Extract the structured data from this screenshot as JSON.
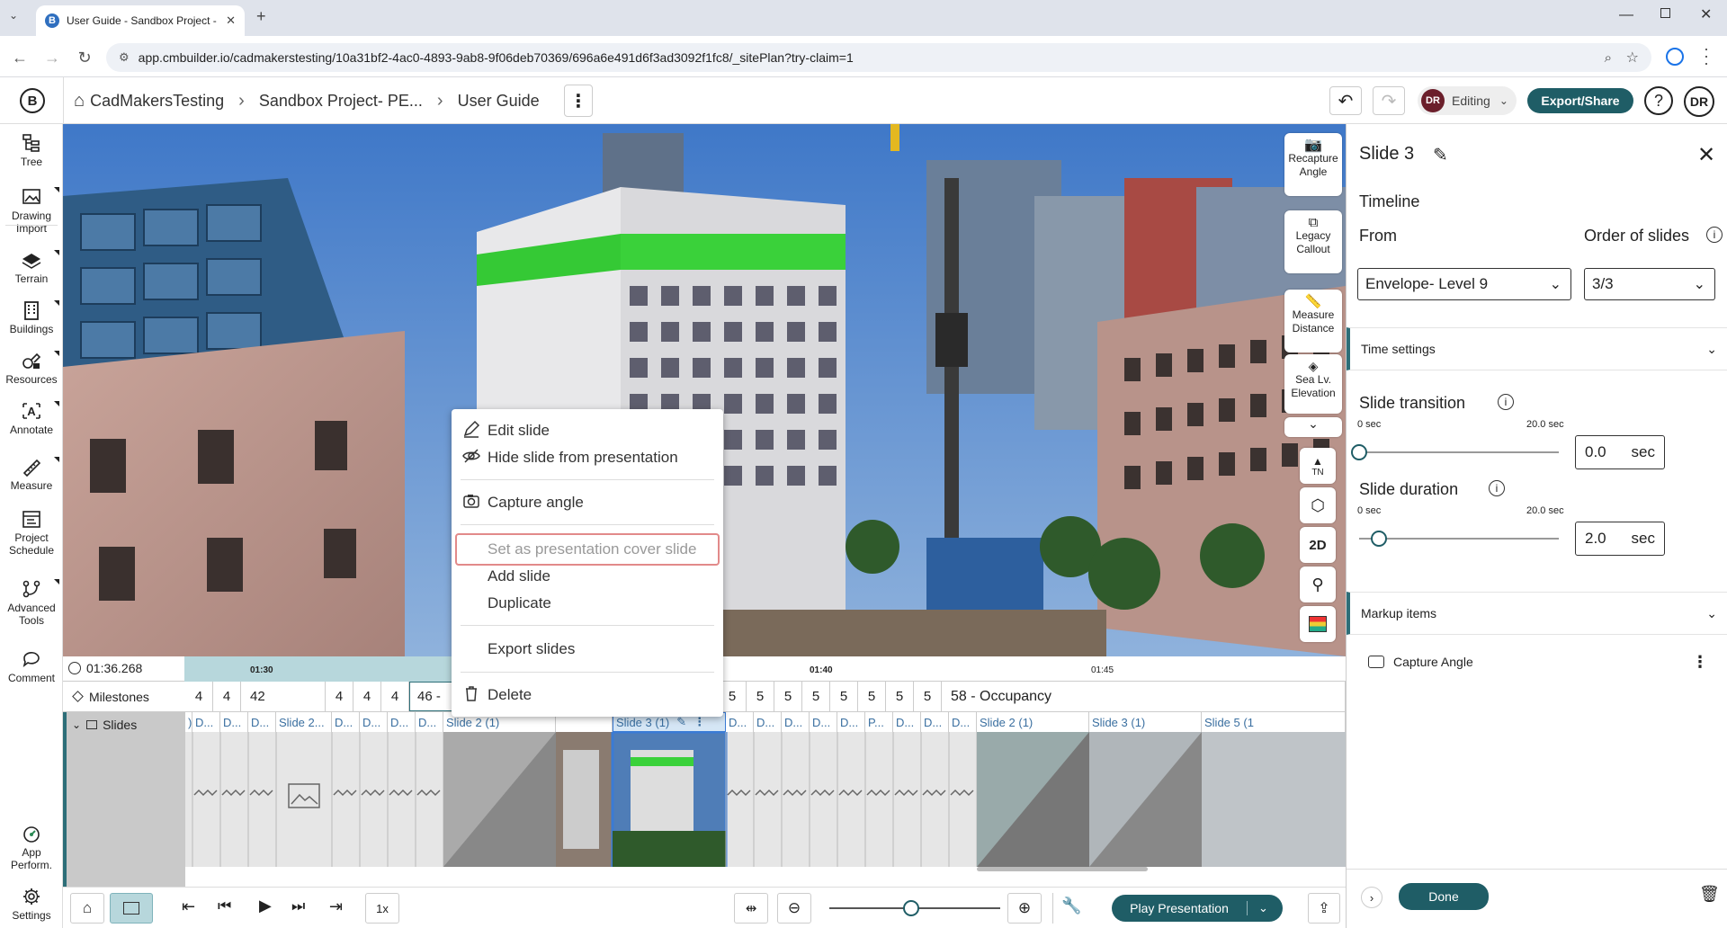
{
  "browser": {
    "tab_title": "User Guide - Sandbox Project -",
    "favicon_letter": "B",
    "url": "app.cmbuilder.io/cadmakerstesting/10a31bf2-4ac0-4893-9ab8-9f06deb70369/696a6e491d6f3ad3092f1fc8/_sitePlan?try-claim=1"
  },
  "header": {
    "logo": "B",
    "breadcrumb": [
      "CadMakersTesting",
      "Sandbox Project- PE...",
      "User Guide"
    ],
    "mode_initials": "DR",
    "mode_label": "Editing",
    "export_label": "Export/Share",
    "help": "?",
    "user_initials": "DR"
  },
  "sidebar": {
    "items": [
      {
        "label": "Tree",
        "icon": "tree-icon"
      },
      {
        "label": "Drawing Import",
        "icon": "drawing-import-icon"
      },
      {
        "label": "Terrain",
        "icon": "terrain-icon"
      },
      {
        "label": "Buildings",
        "icon": "buildings-icon"
      },
      {
        "label": "Resources",
        "icon": "resources-icon"
      },
      {
        "label": "Annotate",
        "icon": "annotate-icon"
      },
      {
        "label": "Measure",
        "icon": "measure-icon"
      },
      {
        "label": "Project Schedule",
        "icon": "project-schedule-icon"
      },
      {
        "label": "Advanced Tools",
        "icon": "advanced-tools-icon"
      },
      {
        "label": "Comment",
        "icon": "comment-icon"
      }
    ],
    "bottom_items": [
      {
        "label": "App Perform.",
        "icon": "app-performance-icon"
      },
      {
        "label": "Settings",
        "icon": "settings-icon"
      }
    ]
  },
  "viewport_tools": {
    "recapture": "Recapture Angle",
    "legacy": "Legacy Callout",
    "measure": "Measure Distance",
    "sealevel": "Sea Lv. Elevation",
    "north": "TN",
    "twod": "2D"
  },
  "context_menu": {
    "edit": "Edit slide",
    "hide": "Hide slide from presentation",
    "capture": "Capture angle",
    "cover": "Set as presentation cover slide",
    "add": "Add slide",
    "duplicate": "Duplicate",
    "export": "Export slides",
    "delete": "Delete"
  },
  "timeline": {
    "current_time": "01:36.268",
    "ticks": [
      "01:30",
      "01:40",
      "01:45"
    ],
    "milestones_label": "Milestones",
    "slides_label": "Slides",
    "milestones": [
      "4",
      "4",
      "42",
      "4",
      "4",
      "4",
      "46 -",
      "4",
      "4",
      "4",
      "5",
      "5",
      "5",
      "5",
      "5",
      "5",
      "5",
      "5",
      "58 - Occupancy"
    ],
    "slide_labels": [
      ")",
      "D...",
      "D...",
      "D...",
      "Slide 2...",
      "D...",
      "D...",
      "D...",
      "D...",
      "Slide 2 (1)",
      "",
      "Slide 3 (1)",
      "D...",
      "D...",
      "D...",
      "D...",
      "D...",
      "P...",
      "D...",
      "D...",
      "D...",
      "Slide 2 (1)",
      "Slide 3 (1)",
      "Slide 5 (1"
    ]
  },
  "bottom_bar": {
    "speed": "1x",
    "play_label": "Play Presentation",
    "zoom_level": 0.48
  },
  "panel": {
    "title": "Slide 3",
    "timeline_heading": "Timeline",
    "from_label": "From",
    "from_value": "Envelope- Level 9",
    "order_label": "Order of slides",
    "order_value": "3/3",
    "time_settings": "Time settings",
    "transition_label": "Slide transition",
    "transition_min": "0 sec",
    "transition_max": "20.0 sec",
    "transition_value": "0.0",
    "duration_label": "Slide duration",
    "duration_min": "0 sec",
    "duration_max": "20.0 sec",
    "duration_value": "2.0",
    "unit": "sec",
    "markup_items": "Markup items",
    "capture_angle": "Capture Angle",
    "done_label": "Done"
  }
}
